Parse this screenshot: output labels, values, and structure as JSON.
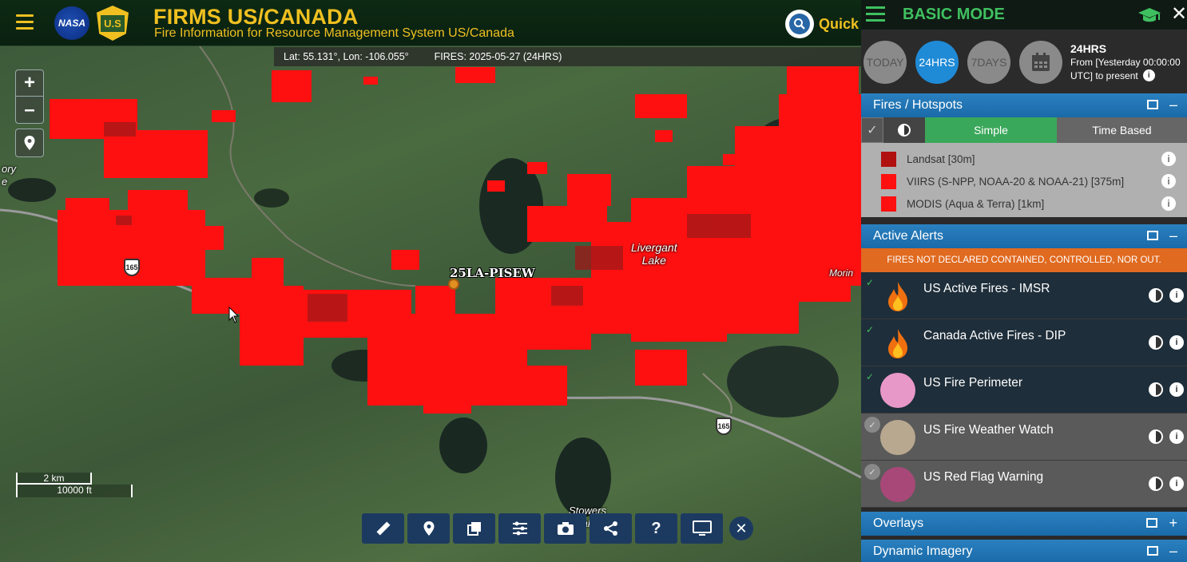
{
  "header": {
    "title": "FIRMS US/CANADA",
    "subtitle": "Fire Information for Resource Management System US/Canada",
    "nasa_logo": "NASA",
    "usfs_logo": "U.S",
    "quick_label": "Quick"
  },
  "map": {
    "coords": "Lat: 55.131°, Lon: -106.055°",
    "fires": "FIRES: 2025-05-27 (24HRS)",
    "zoom_in": "+",
    "zoom_out": "–",
    "left_edge_label": "ory\ne",
    "lake_label": "Livergant\nLake",
    "right_edge_label": "Morin",
    "bottom_label": "Stowers\nLake",
    "fire_name": "25LA-PISEW",
    "road_1": "165",
    "road_2": "165",
    "scale_km": "2 km",
    "scale_ft": "10000 ft"
  },
  "toolbar": {
    "icons": [
      "ruler-icon",
      "pin-icon",
      "layers-icon",
      "sliders-icon",
      "camera-icon",
      "share-icon",
      "help-icon",
      "monitor-icon"
    ],
    "help": "?",
    "close": "✕"
  },
  "panel": {
    "mode": "BASIC MODE",
    "close": "✕",
    "time_buttons": [
      {
        "label": "TODAY",
        "active": false
      },
      {
        "label": "24HRS",
        "active": true
      },
      {
        "label": "7DAYS",
        "active": false
      }
    ],
    "time_title": "24HRS",
    "time_desc_1": "From [Yesterday 00:00:00",
    "time_desc_2": "UTC] to present",
    "fires_section": "Fires / Hotspots",
    "tab_simple": "Simple",
    "tab_time": "Time Based",
    "legend": [
      {
        "label": "Landsat [30m]",
        "color": "#b01010"
      },
      {
        "label": "VIIRS (S-NPP, NOAA-20 & NOAA-21) [375m]",
        "color": "#ff1010"
      },
      {
        "label": "MODIS (Aqua & Terra) [1km]",
        "color": "#ff1010"
      }
    ],
    "alerts_section": "Active Alerts",
    "alert_banner": "FIRES NOT DECLARED CONTAINED, CONTROLLED, NOR OUT.",
    "alerts": [
      {
        "label": "US Active Fires - IMSR",
        "on": true,
        "icon": "fire-icon"
      },
      {
        "label": "Canada Active Fires - DIP",
        "on": true,
        "icon": "fire-icon"
      },
      {
        "label": "US Fire Perimeter",
        "on": true,
        "icon": "perimeter-icon",
        "color": "#e898c8"
      },
      {
        "label": "US Fire Weather Watch",
        "on": false,
        "icon": "watch-icon",
        "color": "#b8a890"
      },
      {
        "label": "US Red Flag Warning",
        "on": false,
        "icon": "redflag-icon",
        "color": "#a84878"
      }
    ],
    "overlays_section": "Overlays",
    "dynamic_section": "Dynamic Imagery"
  }
}
